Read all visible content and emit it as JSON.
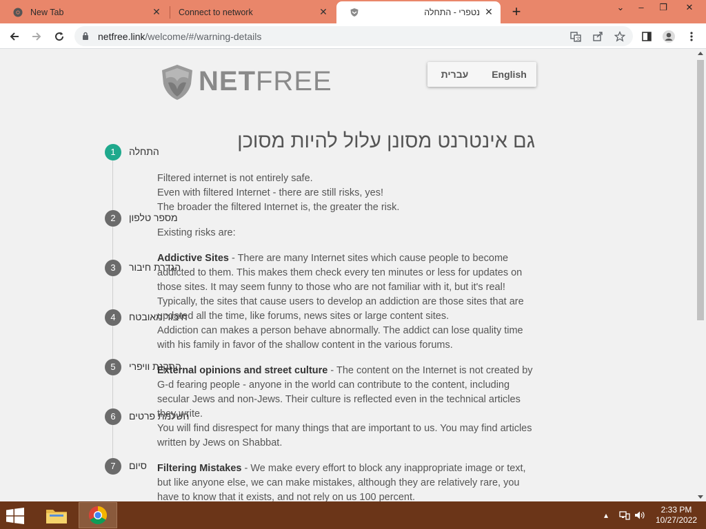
{
  "browser": {
    "tabs": [
      {
        "title": "New Tab",
        "active": false
      },
      {
        "title": "Connect to network",
        "active": false
      },
      {
        "title": "נטפרי - התחלה",
        "active": true
      }
    ],
    "new_tab_symbol": "+",
    "url_host": "netfree.link",
    "url_path": "/welcome/#/warning-details",
    "accent_color": "#e9866a"
  },
  "page": {
    "logo_bold": "NET",
    "logo_light": "FREE",
    "languages": [
      "עברית",
      "English"
    ],
    "heading": "גם אינטרנט מסונן עלול להיות מסוכן",
    "steps": [
      {
        "num": "1",
        "label": "התחלה",
        "active": true
      },
      {
        "num": "2",
        "label": "מספר טלפון",
        "active": false
      },
      {
        "num": "3",
        "label": "הגדרת חיבור",
        "active": false
      },
      {
        "num": "4",
        "label": "חיבור מאובטח",
        "active": false
      },
      {
        "num": "5",
        "label": "התקנת וויפרי",
        "active": false
      },
      {
        "num": "6",
        "label": "השלמת פרטים",
        "active": false
      },
      {
        "num": "7",
        "label": "סיום",
        "active": false
      }
    ],
    "intro": [
      "Filtered internet is not entirely safe.",
      "Even with filtered Internet - there are still risks, yes!",
      "The broader the filtered Internet is, the greater the risk."
    ],
    "risks_intro": "Existing risks are:",
    "risk1_title": "Addictive Sites",
    "risk1_text": " - There are many Internet sites which cause people to become addicted to them. This makes them check every ten minutes or less for updates on those sites. It may seem funny to those who are not familiar with it, but it's real! Typically, the sites that cause users to develop an addiction are those sites that are updated all the time, like forums, news sites or large content sites.",
    "risk1_text2": "Addiction can makes a person behave abnormally. The addict can lose quality time with his family in favor of the shallow content in the various forums.",
    "risk2_title": "External opinions and street culture",
    "risk2_text": " - The content on the Internet is not created by G-d fearing people - anyone in the world can contribute to the content, including secular Jews and non-Jews. Their culture is reflected even in the technical articles they write.",
    "risk2_text2": "You will find disrespect for many things that are important to us. You may find articles written by Jews on Shabbat.",
    "risk3_title": "Filtering Mistakes",
    "risk3_text": " - We make every effort to block any inappropriate image or text, but like anyone else, we can make mistakes, although they are relatively rare, you have to know that it exists, and not rely on us 100 percent."
  },
  "taskbar": {
    "time": "2:33 PM",
    "date": "10/27/2022"
  }
}
